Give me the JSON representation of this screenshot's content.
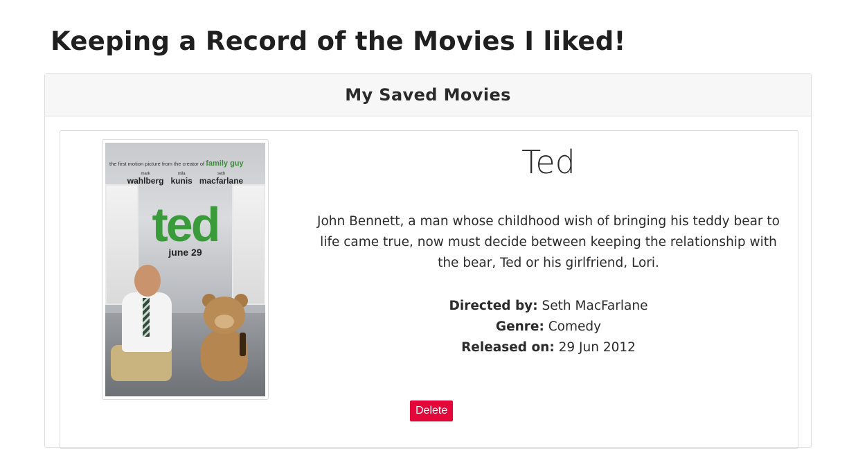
{
  "page": {
    "title": "Keeping a Record of the Movies I liked!"
  },
  "saved_movies": {
    "header": "My Saved Movies",
    "movies": [
      {
        "title": "Ted",
        "plot": "John Bennett, a man whose childhood wish of bringing his teddy bear to life came true, now must decide between keeping the relationship with the bear, Ted or his girlfriend, Lori.",
        "director_label": "Directed by:",
        "director": "Seth MacFarlane",
        "genre_label": "Genre:",
        "genre": "Comedy",
        "released_label": "Released on:",
        "released": "29 Jun 2012",
        "delete_label": "Delete",
        "poster": {
          "tagline": "the first motion picture from the creator of",
          "tagline_brand": "family guy",
          "cast": [
            {
              "first": "mark",
              "last": "wahlberg"
            },
            {
              "first": "mila",
              "last": "kunis"
            },
            {
              "first": "seth",
              "last": "macfarlane"
            }
          ],
          "title": "ted",
          "date": "june 29"
        }
      }
    ]
  },
  "colors": {
    "delete_button": "#e3073a",
    "poster_title": "#3a9b3a",
    "header_bg": "#f7f7f7"
  }
}
